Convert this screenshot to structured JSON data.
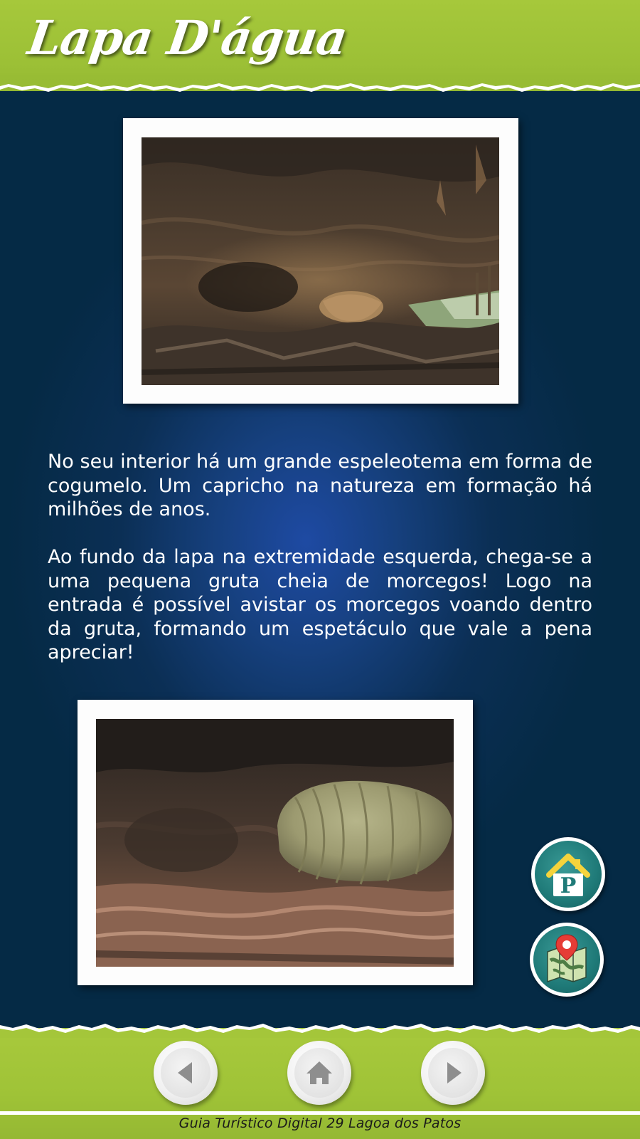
{
  "header": {
    "title": "Lapa D'água"
  },
  "content": {
    "paragraph_1": "No seu interior há um grande espeleotema em forma de cogumelo. Um capricho na natureza em formação há milhões de anos.",
    "paragraph_2": "Ao fundo da lapa na extremidade esquerda, chega-se a uma pequena gruta cheia de morcegos! Logo na entrada é possível avistar os morcegos voando dentro da gruta, formando um espetáculo que vale a pena apreciar!"
  },
  "photos": [
    {
      "subject": "cave-ceiling-photo"
    },
    {
      "subject": "mushroom-speleothem-photo"
    }
  ],
  "side_actions": {
    "parking_letter": "P",
    "parking_icon": "house-parking-icon",
    "map_icon": "map-pin-icon"
  },
  "footer": {
    "caption": "Guia Turístico Digital 29 Lagoa dos Patos",
    "prev_icon": "triangle-left-icon",
    "home_icon": "house-icon",
    "next_icon": "triangle-right-icon"
  },
  "colors": {
    "green": "#9fc337",
    "navy": "#052a45",
    "blue_glow": "#1e4aa3",
    "teal": "#1f7a78"
  }
}
